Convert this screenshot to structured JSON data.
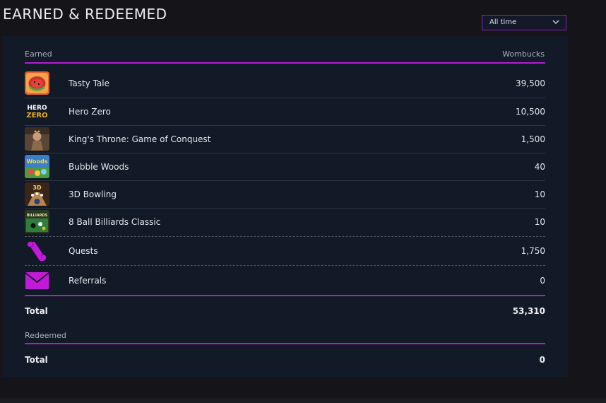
{
  "page": {
    "title": "EARNED & REDEEMED"
  },
  "filter": {
    "selected": "All time"
  },
  "earned": {
    "header_label": "Earned",
    "currency_label": "Wombucks",
    "rows": [
      {
        "name": "Tasty Tale",
        "value": "39,500",
        "icon": "tasty-tale-thumbnail"
      },
      {
        "name": "Hero Zero",
        "value": "10,500",
        "icon": "hero-zero-logo"
      },
      {
        "name": "King's Throne: Game of Conquest",
        "value": "1,500",
        "icon": "kings-throne-thumbnail"
      },
      {
        "name": "Bubble Woods",
        "value": "40",
        "icon": "bubble-woods-thumbnail"
      },
      {
        "name": "3D Bowling",
        "value": "10",
        "icon": "3d-bowling-thumbnail"
      },
      {
        "name": "8 Ball Billiards Classic",
        "value": "10",
        "icon": "billiards-thumbnail"
      },
      {
        "name": "Quests",
        "value": "1,750",
        "icon": "scroll-icon"
      },
      {
        "name": "Referrals",
        "value": "0",
        "icon": "envelope-icon"
      }
    ],
    "total_label": "Total",
    "total_value": "53,310",
    "thumb_text": {
      "hero_line1": "HERO",
      "hero_line2": "ZERO",
      "bubble": "Woods",
      "bowling": "3D",
      "billiards": "BILLIARDS"
    }
  },
  "redeemed": {
    "header_label": "Redeemed",
    "total_label": "Total",
    "total_value": "0"
  },
  "colors": {
    "accent": "#b41ad6",
    "panel": "#111a26",
    "background": "#151519"
  }
}
